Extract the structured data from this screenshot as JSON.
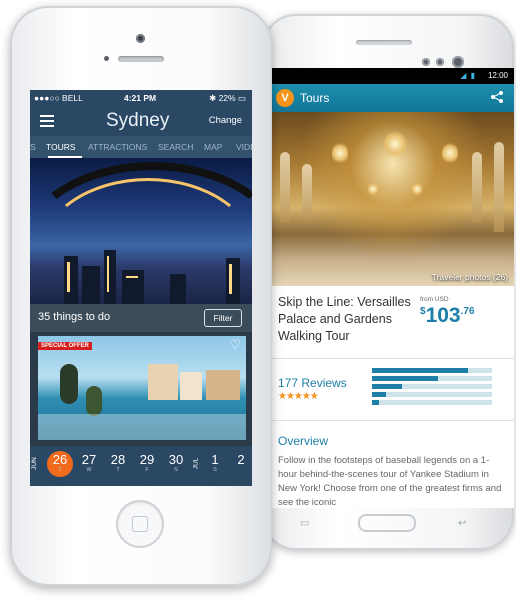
{
  "android": {
    "status_time": "12:00",
    "app_title": "Tours",
    "logo_letter": "V",
    "photo_caption": "Traveler photos (26)",
    "tour_title": "Skip the Line: Versailles Palace and Gardens Walking Tour",
    "price_from": "from USD",
    "price_currency": "$",
    "price_main": "103",
    "price_cents": ".76",
    "reviews": "177 Reviews",
    "rating_bars": [
      0.8,
      0.55,
      0.25,
      0.12,
      0.06
    ],
    "overview_title": "Overview",
    "overview_text": "Follow in the footsteps of baseball legends on a 1-hour behind-the-scenes tour of Yankee Stadium in New York! Choose from one of the greatest firms and see the iconic"
  },
  "iphone": {
    "carrier": "●●●○○ BELL",
    "time": "4:21 PM",
    "battery": "22%",
    "city": "Sydney",
    "change_label": "Change",
    "tabs": [
      "S",
      "TOURS",
      "ATTRACTIONS",
      "SEARCH",
      "MAP",
      "VIDE"
    ],
    "count_text": "35 things to do",
    "filter_label": "Filter",
    "special_offer": "SPECIAL OFFER",
    "month_left": "JUN",
    "month_right": "JUL",
    "dates": [
      {
        "num": "26",
        "day": "T"
      },
      {
        "num": "27",
        "day": "W"
      },
      {
        "num": "28",
        "day": "T"
      },
      {
        "num": "29",
        "day": "F"
      },
      {
        "num": "30",
        "day": "S"
      },
      {
        "num": "1",
        "day": "S"
      },
      {
        "num": "2",
        "day": ""
      }
    ]
  },
  "colors": {
    "accent_blue": "#1d7fa8",
    "orange": "#f26b1d",
    "navy": "#2a4763"
  }
}
